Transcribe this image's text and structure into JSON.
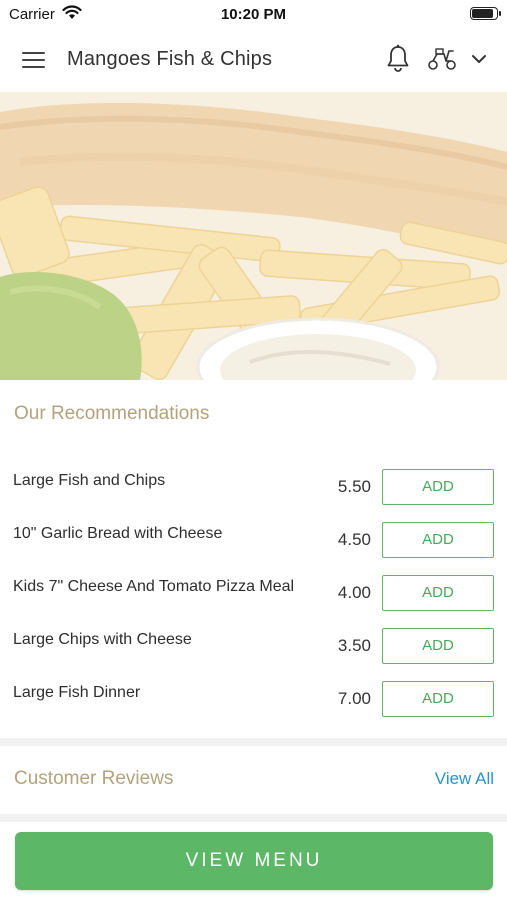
{
  "status_bar": {
    "carrier": "Carrier",
    "time": "10:20 PM",
    "wifi_icon": "wifi-icon",
    "battery_icon": "battery-icon",
    "battery_level": 0.9
  },
  "app_bar": {
    "title": "Mangoes Fish & Chips",
    "menu_icon": "hamburger-menu-icon",
    "notification_icon": "bell-icon",
    "delivery_icon": "scooter-icon",
    "dropdown_icon": "chevron-down-icon"
  },
  "hero": {
    "image": "fish-and-chips-photo"
  },
  "recommendations": {
    "title": "Our Recommendations",
    "items": [
      {
        "name": "Large Fish and Chips",
        "price": "5.50",
        "action": "ADD"
      },
      {
        "name": "10\" Garlic Bread with Cheese",
        "price": "4.50",
        "action": "ADD"
      },
      {
        "name": "Kids 7\" Cheese And Tomato Pizza Meal",
        "price": "4.00",
        "action": "ADD"
      },
      {
        "name": "Large Chips with Cheese",
        "price": "3.50",
        "action": "ADD"
      },
      {
        "name": "Large Fish Dinner",
        "price": "7.00",
        "action": "ADD"
      }
    ]
  },
  "reviews": {
    "title": "Customer Reviews",
    "view_all": "View All"
  },
  "cta": {
    "label": "VIEW MENU"
  },
  "colors": {
    "accent_green": "#5cb766",
    "section_title": "#b3a27c",
    "link_blue": "#2a93c9"
  }
}
